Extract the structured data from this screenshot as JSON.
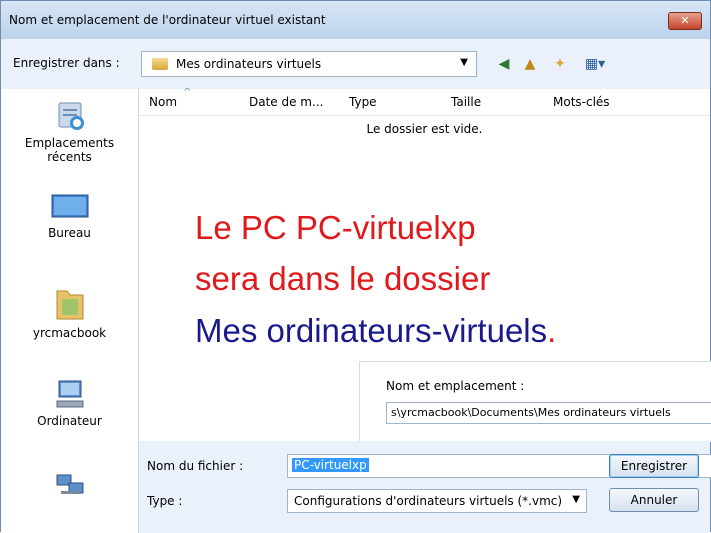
{
  "window": {
    "title": "Nom et emplacement de l'ordinateur virtuel existant",
    "close_label": "✕"
  },
  "toolbar": {
    "save_in_label": "Enregistrer dans :",
    "location": "Mes ordinateurs virtuels",
    "icons": [
      "back-icon",
      "up-folder-icon",
      "new-folder-icon",
      "views-icon"
    ]
  },
  "sidebar": {
    "items": [
      {
        "label": "Emplacements\nrécents",
        "icon": "recent-places-icon"
      },
      {
        "label": "Bureau",
        "icon": "desktop-icon"
      },
      {
        "label": "yrcmacbook",
        "icon": "user-folder-icon"
      },
      {
        "label": "Ordinateur",
        "icon": "computer-icon"
      },
      {
        "label": "",
        "icon": "network-icon"
      }
    ]
  },
  "filelist": {
    "columns": [
      "Nom",
      "Date de m...",
      "Type",
      "Taille",
      "Mots-clés"
    ],
    "empty_message": "Le dossier est vide."
  },
  "overlay": {
    "line1": "Le PC PC-virtuelxp",
    "line2": "sera dans le dossier",
    "line3": "Mes ordinateurs-virtuels",
    "line3_end": ".",
    "red": "#e0191b",
    "blue": "#1a1a8c"
  },
  "popup": {
    "label": "Nom et emplacement :",
    "value": "s\\yrcmacbook\\Documents\\Mes ordinateurs virtuels"
  },
  "bottom": {
    "filename_label": "Nom du fichier :",
    "filename_value": "PC-virtuelxp",
    "type_label": "Type :",
    "type_value": "Configurations d'ordinateurs virtuels (*.vmc)",
    "save_button": "Enregistrer",
    "cancel_button": "Annuler"
  }
}
